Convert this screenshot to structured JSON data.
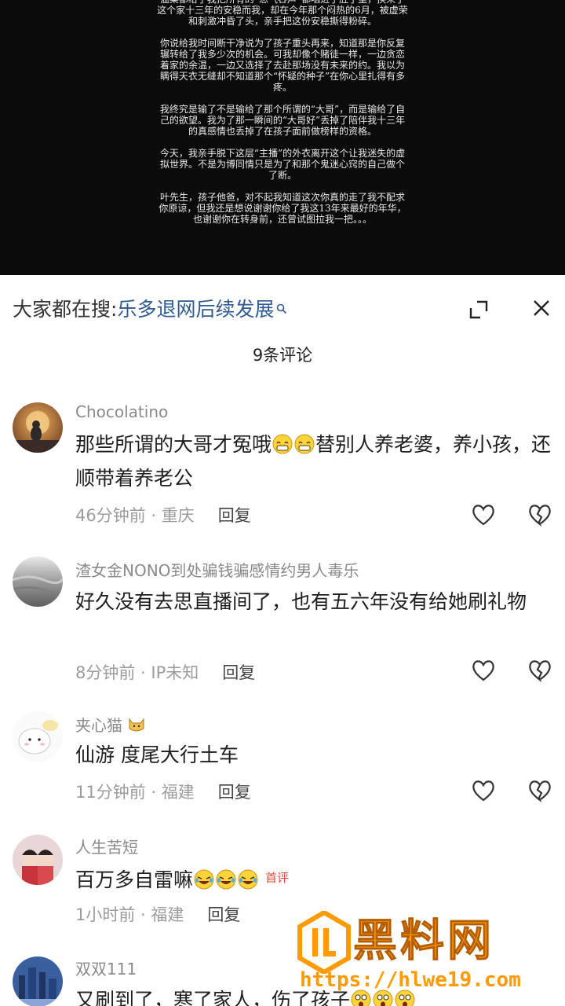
{
  "video": {
    "paragraphs": [
      "温柔都给了我把所有的“怨气吞声”都咽进了肚子里，换来了这个家十三年的安稳而我，却在今年那个闷热的6月，被虚荣和刺激冲昏了头，亲手把这份安稳撕得粉碎。",
      "你说给我时间断干净说为了孩子重头再来，知道那是你反复辗转给了我多少次的机会。可我却像个赌徒一样，一边贪恋着家的余温，一边又选择了去赴那场没有未来的约。我以为瞒得天衣无缝却不知道那个“怀疑的种子”在你心里扎得有多疼。",
      "我终究是输了不是输给了那个所谓的“大哥”，而是输给了自己的欲望。我为了那一瞬间的“大哥好”丢掉了陪伴我十三年的真感情也丢掉了在孩子面前做榜样的资格。",
      "今天，我亲手脱下这层“主播”的外衣离开这个让我迷失的虚拟世界。不是为博同情只是为了和那个鬼迷心窍的自己做个了断。",
      "叶先生，孩子他爸，对不起我知道这次你真的走了我不配求你原谅，但我还是想说谢谢你给了我这13年来最好的年华，也谢谢你在转身前，还曾试图拉我一把。。。"
    ]
  },
  "search": {
    "prefix": "大家都在搜:",
    "query": "乐多退网后续发展"
  },
  "comments_header": "9条评论",
  "comments": [
    {
      "username": "Chocolatino",
      "text_before": "那些所谓的大哥才冤哦",
      "text_after": "替别人养老婆，养小孩，还顺带着养老公",
      "time": "46分钟前",
      "location": "重庆",
      "reply": "回复"
    },
    {
      "username": "渣女金NONO到处骗钱骗感情约男人毒乐",
      "text": "好久没有去思直播间了，也有五六年没有给她刷礼物",
      "time": "8分钟前",
      "location": "IP未知",
      "reply": "回复"
    },
    {
      "username": "夹心猫",
      "text": "仙游 度尾大行土车",
      "time": "11分钟前",
      "location": "福建",
      "reply": "回复"
    },
    {
      "username": "人生苦短",
      "text": "百万多自雷嘛",
      "badge": "首评",
      "time": "1小时前",
      "location": "福建",
      "reply": "回复"
    },
    {
      "username": "双双111",
      "text": "又刷到了，寒了家人，伤了孩子"
    }
  ],
  "meta_separator": " · ",
  "watermark": {
    "title": "黑料网",
    "url": "https://hlwe19.com"
  },
  "icons": {
    "search": "search-icon",
    "expand": "expand-icon",
    "close": "close-icon",
    "like": "heart-icon",
    "dislike": "broken-heart-icon"
  },
  "colors": {
    "link": "#2f5a93",
    "badge": "#e0493c",
    "watermark": "#ff9a00"
  }
}
